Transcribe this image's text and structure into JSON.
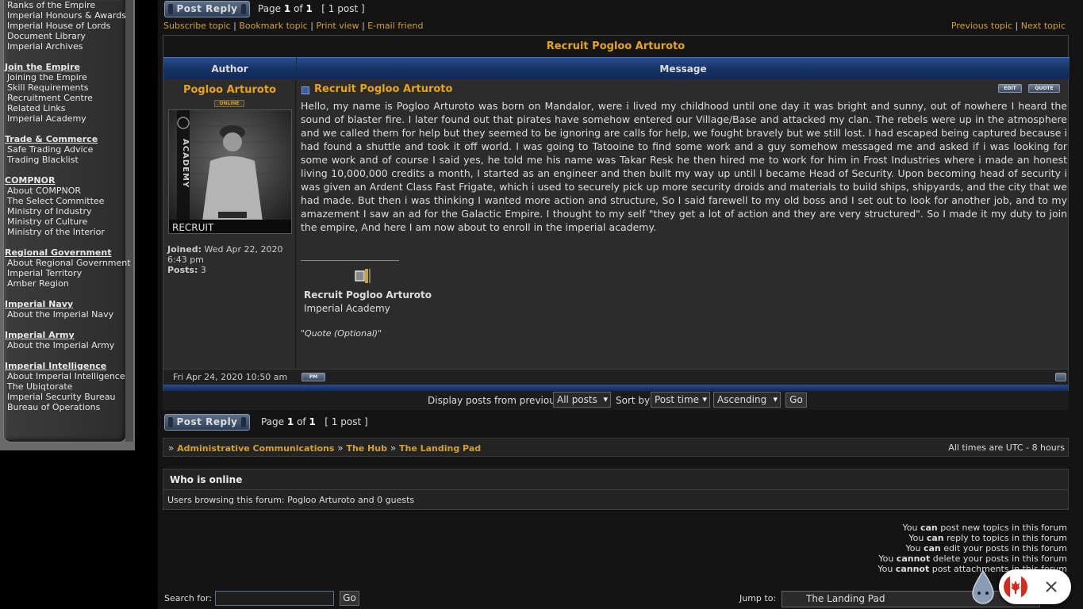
{
  "sidebar": {
    "groups": [
      {
        "heading": "",
        "items": [
          "Ranks of the Empire",
          "Imperial Honours & Awards",
          "Imperial House of Lords",
          "Document Library",
          "Imperial Archives"
        ]
      },
      {
        "heading": "Join the Empire",
        "items": [
          "Joining the Empire",
          "Skill Requirements",
          "Recruitment Centre",
          "Related Links",
          "Imperial Academy"
        ]
      },
      {
        "heading": "Trade & Commerce",
        "items": [
          "Safe Trading Advice",
          "Trading Blacklist"
        ]
      },
      {
        "heading": "COMPNOR",
        "items": [
          "About COMPNOR",
          "The Select Committee",
          "Ministry of Industry",
          "Ministry of Culture",
          "Ministry of the Interior"
        ]
      },
      {
        "heading": "Regional Government",
        "items": [
          "About Regional Government",
          "Imperial Territory",
          "Amber Region"
        ]
      },
      {
        "heading": "Imperial Navy",
        "items": [
          "About the Imperial Navy"
        ]
      },
      {
        "heading": "Imperial Army",
        "items": [
          "About the Imperial Army"
        ]
      },
      {
        "heading": "Imperial Intelligence",
        "items": [
          "About Imperial Intelligence",
          "The Ubiqtorate",
          "Imperial Security Bureau",
          "Bureau of Operations"
        ]
      }
    ]
  },
  "top": {
    "reply_label": "Post Reply",
    "page_prefix": "Page",
    "page_current": "1",
    "page_of": "of",
    "page_total": "1",
    "post_count": "[ 1 post ]",
    "links": [
      "Subscribe topic",
      "Bookmark topic",
      "Print view",
      "E-mail friend"
    ],
    "prev_topic": "Previous topic",
    "next_topic": "Next topic"
  },
  "topic": {
    "title": "Recruit Pogloo Arturoto",
    "author_header": "Author",
    "message_header": "Message"
  },
  "author": {
    "name": "Pogloo Arturoto",
    "status": "ONLINE",
    "avatar_caption": "RECRUIT",
    "avatar_side_text": "ACADEMY",
    "joined_label": "Joined:",
    "joined_value": "Wed Apr 22, 2020 6:43 pm",
    "posts_label": "Posts:",
    "posts_value": "3"
  },
  "post": {
    "subject": "Recruit Pogloo Arturoto",
    "edit_label": "EDIT",
    "quote_label": "QUOTE",
    "body": "Hello, my name is Pogloo Arturoto was born on Mandalor, were i lived my childhood until one day it was bright and sunny, out of nowhere I heard the sound of blaster fire. I later found out that pirates have somehow entered our Village/Base and attacked my clan. The rebels were up in the atmosphere and we called them for help but they seemed to be ignoring are calls for help, we fought bravely but we still lost. I had escaped being captured because i had found a shuttle and took it off world. I was going to Tatooine to find some work and a guy somehow messaged me and asked if i was looking for some work and of course I said yes, he told me his name was Takar Resk he then hired me to work for him in Frost Industries where i made an honest living 10,000,000 credits a month, I started as an engineer and then built my way up until I became Head of Security. Upon becoming head of security i was given an Ardent Class Fast Frigate, which i used to securely pick up more security droids and materials to build ships, shipyards, and the city that we had made. But then i was thinking I wanted more action and structure, So I said farewell to my old boss and I set out to look for another job, and to my amazement I saw an ad for the Galactic Empire. I thought to my self \"they get a lot of action and they are very structured\". So I made it my duty to join the empire, And here I am now about to enroll in the imperial academy.",
    "sig_name": "Recruit Pogloo Arturoto",
    "sig_unit": "Imperial Academy",
    "sig_quote": "\"Quote (Optional)\"",
    "date": "Fri Apr 24, 2020 10:50 am",
    "pm_label": "PM"
  },
  "display": {
    "label": "Display posts from previous:",
    "posts_value": "All posts",
    "sort_label": "Sort by",
    "sort_value": "Post time",
    "order_value": "Ascending",
    "go_label": "Go"
  },
  "breadcrumb": {
    "sep": "»",
    "items": [
      "Administrative Communications",
      "The Hub",
      "The Landing Pad"
    ],
    "timezone": "All times are UTC - 8 hours"
  },
  "who_online": {
    "title": "Who is online",
    "text": "Users browsing this forum: Pogloo Arturoto and 0 guests"
  },
  "permissions": [
    {
      "pre": "You",
      "verb": "can",
      "post": "post new topics in this forum"
    },
    {
      "pre": "You",
      "verb": "can",
      "post": "reply to topics in this forum"
    },
    {
      "pre": "You",
      "verb": "can",
      "post": "edit your posts in this forum"
    },
    {
      "pre": "You",
      "verb": "cannot",
      "post": "delete your posts in this forum"
    },
    {
      "pre": "You",
      "verb": "cannot",
      "post": "post attachments in this forum"
    }
  ],
  "search": {
    "label": "Search for:",
    "value": "",
    "go_label": "Go"
  },
  "jump": {
    "label": "Jump to:",
    "value": "The Landing Pad"
  },
  "colors": {
    "accent_gold": "#d9a023",
    "header_blue": "#173467",
    "background": "#141414"
  },
  "icons": {
    "popup_close": "close-icon",
    "flag": "canada-flag-icon",
    "mascot": "droplet-mascot-icon"
  }
}
